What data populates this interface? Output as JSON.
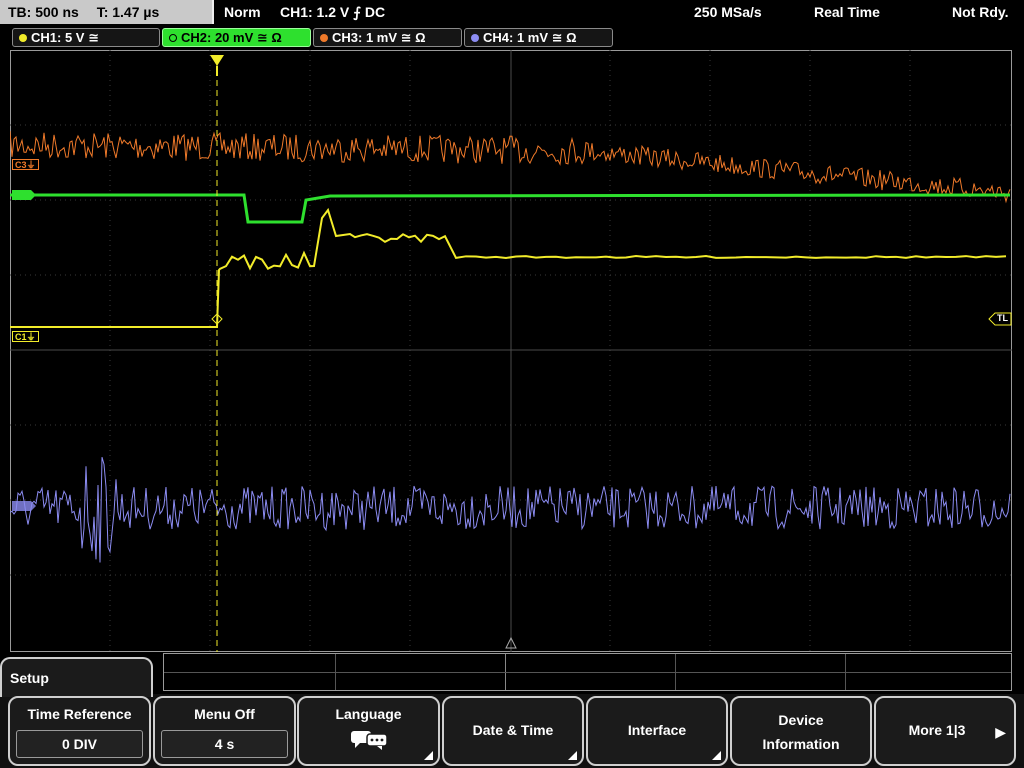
{
  "status": {
    "timebase": "TB: 500 ns",
    "trigger_time": "T: 1.47 µs",
    "mode": "Norm",
    "trigger": "CH1: 1.2 V ⨍ DC",
    "sample_rate": "250 MSa/s",
    "acq_mode": "Real Time",
    "state": "Not Rdy."
  },
  "channels": [
    {
      "label": "CH1: 5 V ≅",
      "color": "#f2ec2a",
      "active": false
    },
    {
      "label": "CH2: 20 mV ≅ Ω",
      "color": "#2ee02e",
      "active": true
    },
    {
      "label": "CH3: 1 mV ≅ Ω",
      "color": "#f07a2a",
      "active": false
    },
    {
      "label": "CH4: 1 mV ≅ Ω",
      "color": "#8c8cf2",
      "active": false
    }
  ],
  "markers": {
    "c3": "C3⏚",
    "c1": "C1⏚",
    "trigger_level": "TL"
  },
  "menu": {
    "tab": "Setup",
    "softkeys": [
      {
        "title": "Time Reference",
        "value": "0 DIV"
      },
      {
        "title": "Menu Off",
        "value": "4 s"
      },
      {
        "title": "Language",
        "icon": "speech-globe-icon"
      },
      {
        "title": "Date & Time"
      },
      {
        "title": "Interface"
      },
      {
        "title_line1": "Device",
        "title_line2": "Information"
      },
      {
        "title": "More 1|3"
      }
    ]
  }
}
